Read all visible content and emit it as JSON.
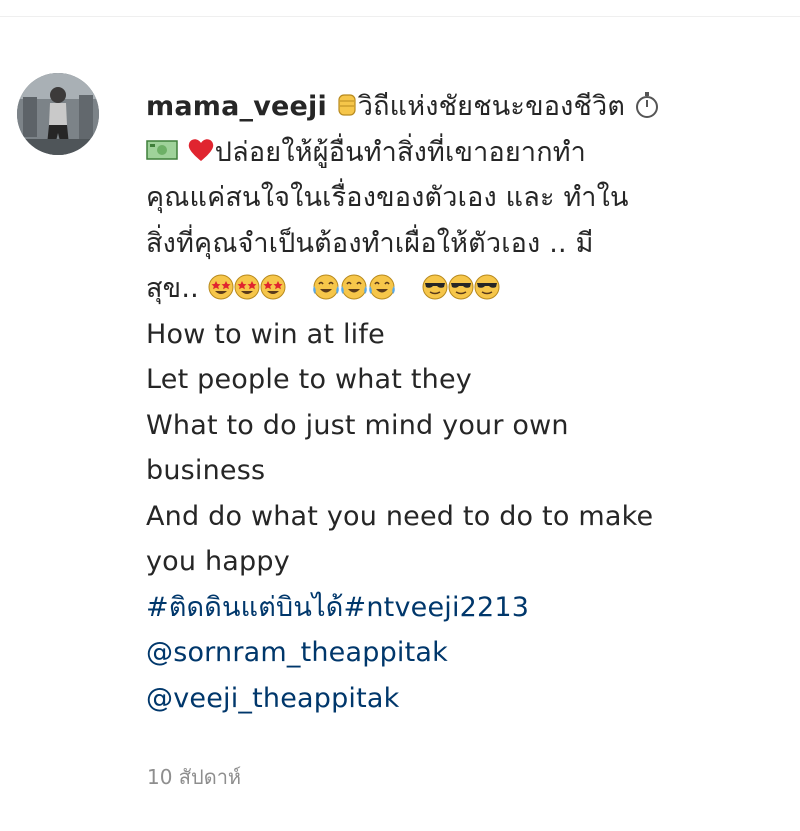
{
  "post": {
    "username": "mama_veeji",
    "caption_lines": {
      "l1": "วิถีแห่งชัยชนะของชีวิต",
      "l2": "ปล่อยให้ผู้อื่นทำสิ่งที่เขาอยากทำ",
      "l3": "คุณแค่สนใจในเรื่องของตัวเอง และ ทำใน",
      "l4": "สิ่งที่คุณจำเป็นต้องทำเผื่อให้ตัวเอง .. มี",
      "l5": "สุข..",
      "l6": "How to win at life",
      "l7": "Let people to what they",
      "l8": "What to do just mind your own",
      "l9": "business",
      "l10": "And do what you need to do to make",
      "l11": "you happy"
    },
    "hashtags": "#ติดดินแต่บินได้#ntveeji2213",
    "mention_1": "@sornram_theappitak",
    "mention_2": "@veeji_theappitak",
    "timestamp": "10 สัปดาห์"
  },
  "icons": [
    "avatar",
    "raised-fist-icon",
    "stopwatch-icon",
    "money-icon",
    "red-heart-icon",
    "star-struck-emoji-icon",
    "crying-laughing-emoji-icon",
    "sunglasses-emoji-icon"
  ],
  "colors": {
    "text": "#262626",
    "link": "#00376b",
    "muted": "#8e8e8e",
    "emoji_yellow": "#f6c64a"
  }
}
